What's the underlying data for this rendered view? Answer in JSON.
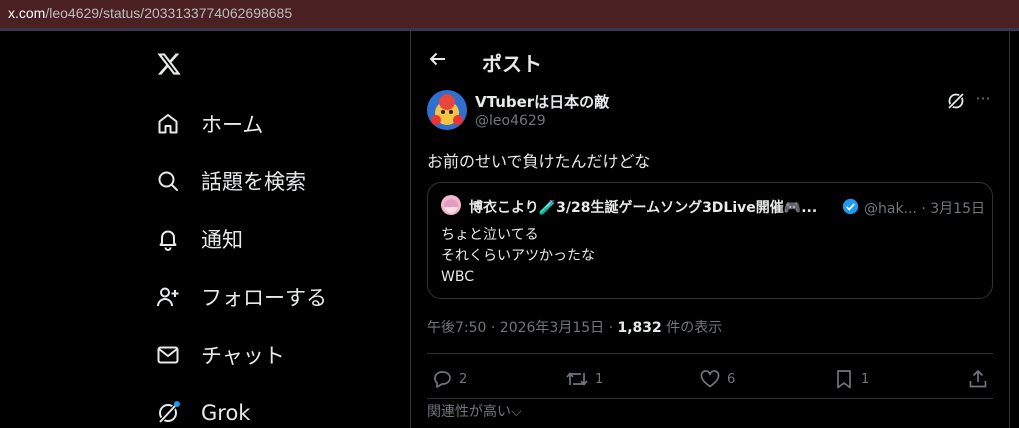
{
  "browser": {
    "url_domain": "x.com",
    "url_path": "/leo4629/status/2033133774062698685"
  },
  "nav": {
    "logo_icon": "x-logo-icon",
    "items": [
      {
        "label": "ホーム",
        "icon": "home-icon"
      },
      {
        "label": "話題を検索",
        "icon": "search-icon"
      },
      {
        "label": "通知",
        "icon": "bell-icon"
      },
      {
        "label": "フォローする",
        "icon": "follow-icon"
      },
      {
        "label": "チャット",
        "icon": "mail-icon"
      },
      {
        "label": "Grok",
        "icon": "grok-icon"
      }
    ]
  },
  "header": {
    "title": "ポスト",
    "back_icon": "back-arrow-icon"
  },
  "tweet": {
    "author_name": "VTuberは日本の敵",
    "author_handle": "@leo4629",
    "text": "お前のせいで負けたんだけどな",
    "time": "午後7:50 · 2026年3月15日 · ",
    "views_count": "1,832",
    "views_label": " 件の表示",
    "quote": {
      "author_name": "博衣こより🧪3/28生誕ゲームソング3DLive開催🎮...",
      "handle_date": "@hak... · 3月15日",
      "lines": [
        "ちょと泣いてる",
        "それくらいアツかったな",
        "WBC"
      ]
    },
    "actions": {
      "replies": "2",
      "reposts": "1",
      "likes": "6",
      "bookmarks": "1"
    },
    "sort_label": "関連性が高い⌵"
  },
  "colors": {
    "background": "#000000",
    "text": "#e7e9ea",
    "secondary": "#71767b",
    "border": "#2f3336",
    "verified": "#1d9bf0",
    "url_bar": "#4a2022"
  }
}
